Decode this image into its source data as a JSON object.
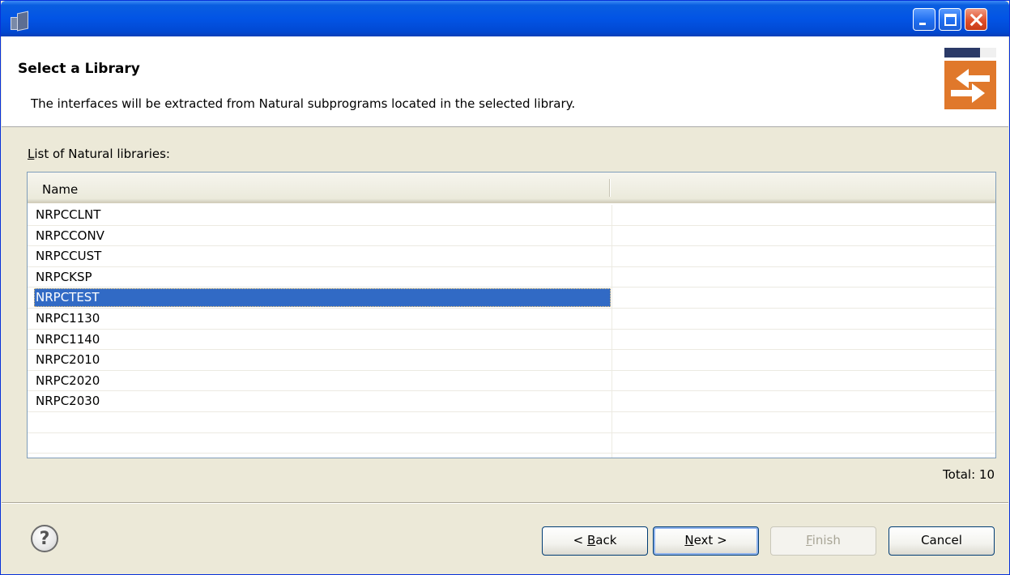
{
  "titlebar": {
    "title": ""
  },
  "header": {
    "title": "Select a Library",
    "description": "The interfaces will be extracted from Natural subprograms located in the selected library."
  },
  "list": {
    "label_mnemonic": "L",
    "label_rest": "ist of Natural libraries:",
    "columns": [
      "Name",
      ""
    ],
    "rows": [
      "NRPCCLNT",
      "NRPCCONV",
      "NRPCCUST",
      "NRPCKSP",
      "NRPCTEST",
      "NRPC1130",
      "NRPC1140",
      "NRPC2010",
      "NRPC2020",
      "NRPC2030"
    ],
    "selected": "NRPCTEST",
    "total": "Total: 10"
  },
  "buttons": {
    "back_prefix": "< ",
    "back_mnemonic": "B",
    "back_rest": "ack",
    "next_mnemonic": "N",
    "next_rest": "ext >",
    "finish_mnemonic": "F",
    "finish_rest": "inish",
    "cancel": "Cancel"
  },
  "help": {
    "glyph": "?"
  },
  "colors": {
    "titlebar": "#0254e5",
    "selection": "#316ac5",
    "dialog_bg": "#ece9d8",
    "wizard_accent": "#e0782b"
  },
  "icons": [
    "app-icon",
    "minimize-icon",
    "maximize-icon",
    "close-icon",
    "wizard-graphic",
    "help-icon"
  ]
}
